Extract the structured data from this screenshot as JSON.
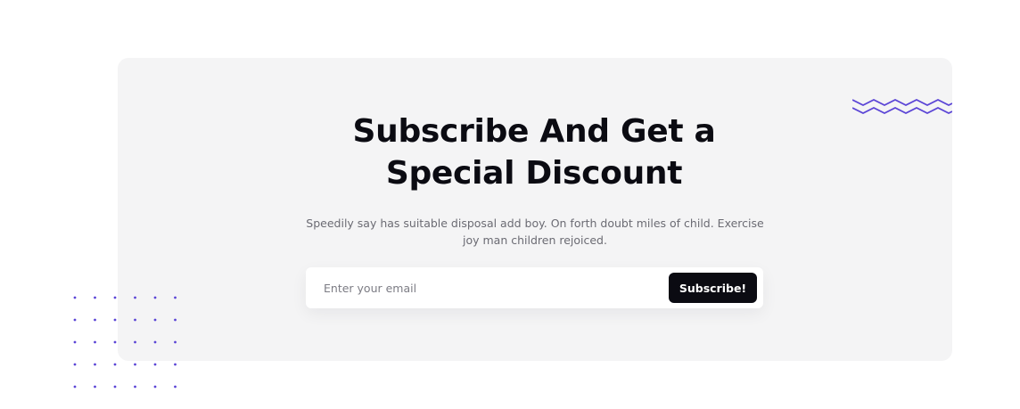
{
  "subscribe": {
    "title_line1": "Subscribe And Get a",
    "title_line2": "Special Discount",
    "description": "Speedily say has suitable disposal add boy. On forth doubt miles of child. Exercise joy man children rejoiced.",
    "email_placeholder": "Enter your email",
    "button_label": "Subscribe!"
  },
  "colors": {
    "card_background": "#f4f4f5",
    "button_background": "#0b0b12",
    "accent_purple": "#5b45d6"
  },
  "decorations": {
    "top_right": "zigzag-icon",
    "bottom_left": "dot-grid-icon"
  }
}
